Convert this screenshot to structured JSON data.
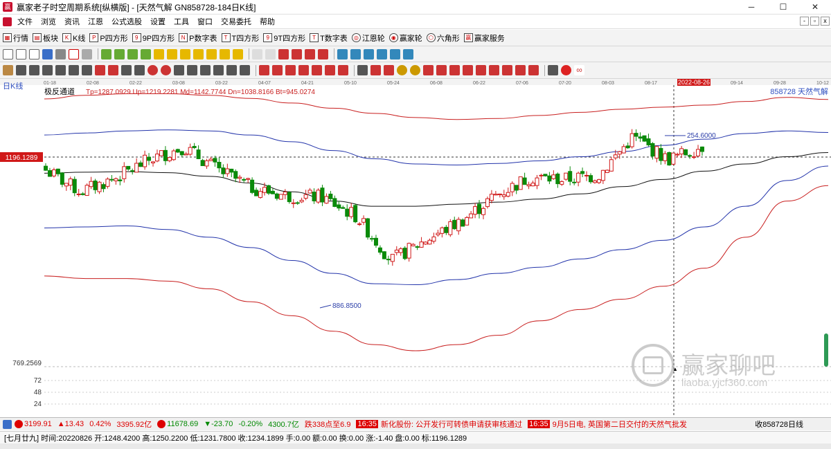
{
  "window": {
    "title": "赢家老子时空周期系统[纵横版] - [天然气解  GN858728-184日K线]",
    "controls": [
      "─",
      "☐",
      "✕"
    ]
  },
  "menu": {
    "items": [
      "文件",
      "浏览",
      "资讯",
      "江恩",
      "公式选股",
      "设置",
      "工具",
      "窗口",
      "交易委托",
      "帮助"
    ]
  },
  "toolbar1": {
    "items": [
      {
        "icon": "grid-icon",
        "label": "行情"
      },
      {
        "icon": "block-icon",
        "label": "板块"
      },
      {
        "icon": "kline-icon",
        "label": "K线"
      },
      {
        "icon": "p-square-icon",
        "label": "P四方形"
      },
      {
        "icon": "9p-square-icon",
        "label": "9P四方形"
      },
      {
        "icon": "pn-table-icon",
        "label": "P数字表"
      },
      {
        "icon": "t-square-icon",
        "label": "T四方形"
      },
      {
        "icon": "9t-square-icon",
        "label": "9T四方形"
      },
      {
        "icon": "tn-table-icon",
        "label": "T数字表"
      },
      {
        "icon": "gann-wheel-icon",
        "label": "江恩轮"
      },
      {
        "icon": "winner-wheel-icon",
        "label": "赢家轮"
      },
      {
        "icon": "hexagon-icon",
        "label": "六角形"
      },
      {
        "icon": "winner-service-icon",
        "label": "赢家服务"
      }
    ]
  },
  "chart": {
    "period_label": "日K线",
    "indicator_name": "极反通道",
    "indicator_values": "Tp=1287.0929  Up=1219.2281  Md=1142.7744  Dn=1038.8166  Bt=945.0274",
    "symbol_label": "858728  天然气解",
    "date_ticks": [
      "01-18",
      "02-08",
      "02-22",
      "03-08",
      "03-22",
      "04-07",
      "04-21",
      "05-10",
      "05-24",
      "06-08",
      "06-22",
      "07-06",
      "07-20",
      "08-03",
      "08-17",
      "2022-08-26",
      "09-14",
      "09-28",
      "10-12"
    ],
    "price_ticks": [
      "1196.1289",
      "769.2569"
    ],
    "cursor_price": "1196.1289",
    "volume_ticks": [
      "72",
      "48",
      "24"
    ],
    "high_annotation": "254.6000",
    "low_annotation": "886.8500"
  },
  "chart_data": {
    "type": "candlestick",
    "title": "",
    "symbol": "858728 天然气解",
    "period": "日K线",
    "indicator": {
      "name": "极反通道",
      "Tp": 1287.0929,
      "Up": 1219.2281,
      "Md": 1142.7744,
      "Dn": 1038.8166,
      "Bt": 945.0274
    },
    "ylim": [
      769.2569,
      1300
    ],
    "highlighted_date": "2022-08-26",
    "annotations": [
      {
        "label": "254.6000",
        "near": "peak"
      },
      {
        "label": "886.8500",
        "near": "trough"
      }
    ],
    "series": [
      {
        "name": "Tp",
        "color": "#c81e1e",
        "values": [
          1288,
          1295,
          1298,
          1298,
          1295,
          1289,
          1280,
          1270,
          1260,
          1252,
          1248,
          1250,
          1256,
          1262,
          1268,
          1272,
          1276,
          1283,
          1291,
          1287
        ]
      },
      {
        "name": "Up",
        "color": "#2233aa",
        "values": [
          1218,
          1222,
          1226,
          1228,
          1226,
          1218,
          1205,
          1188,
          1172,
          1162,
          1160,
          1163,
          1168,
          1176,
          1186,
          1198,
          1210,
          1221,
          1226,
          1223
        ]
      },
      {
        "name": "Md",
        "color": "#111111",
        "values": [
          1144,
          1146,
          1147,
          1145,
          1138,
          1125,
          1108,
          1090,
          1080,
          1080,
          1084,
          1088,
          1094,
          1104,
          1118,
          1132,
          1148,
          1162,
          1176,
          1184
        ]
      },
      {
        "name": "Dn",
        "color": "#2233aa",
        "values": [
          1038,
          1040,
          1042,
          1035,
          1020,
          1000,
          975,
          950,
          930,
          928,
          938,
          950,
          962,
          978,
          996,
          1014,
          1040,
          1080,
          1130,
          1158
        ]
      },
      {
        "name": "Bt",
        "color": "#c81e1e",
        "values": [
          945,
          940,
          940,
          935,
          920,
          895,
          868,
          838,
          812,
          800,
          812,
          830,
          858,
          880,
          900,
          925,
          960,
          1020,
          1090,
          1120
        ]
      },
      {
        "name": "close",
        "color": "#000000",
        "values": [
          1150,
          1108,
          1134,
          1170,
          1195,
          1150,
          1115,
          1100,
          1098,
          1060,
          975,
          1015,
          1050,
          1100,
          1136,
          1132,
          1140,
          1215,
          1170,
          1196
        ]
      }
    ]
  },
  "statusbar": {
    "sh_index": "3199.91",
    "sh_change": "▲13.43",
    "sh_pct": "0.42%",
    "sh_amount": "3395.92亿",
    "sz_index": "11678.69",
    "sz_change": "▼-23.70",
    "sz_pct": "-0.20%",
    "sz_amount": "4300.7亿",
    "news": [
      {
        "time": "",
        "text": "跌338点至6.9"
      },
      {
        "time": "16:35",
        "text": "新化股份: 公开发行可转债申请获审核通过"
      },
      {
        "time": "16:35",
        "text": "9月5日电, 英国第二日交付的天然气批发"
      }
    ],
    "right_label": "收858728日线",
    "info_line": "[七月廿九] 时间:20220826 开:1248.4200 高:1250.2200 低:1231.7800 收:1234.1899 手:0.00 额:0.00 换:0.00 涨:-1.40 盘:0.00 标:1196.1289"
  },
  "watermark": {
    "line1": "赢家聊吧",
    "line2": "liaoba.yjcf360.com"
  }
}
